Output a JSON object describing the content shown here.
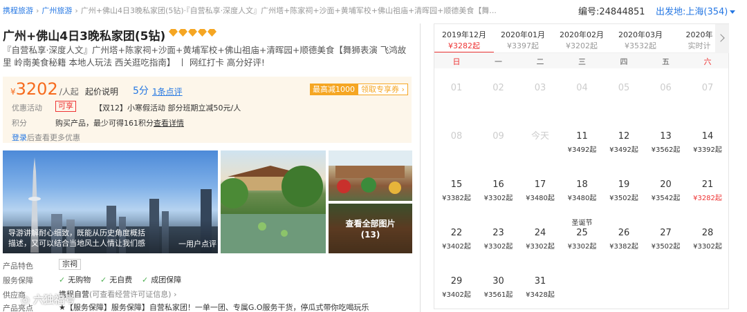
{
  "breadcrumb": {
    "items": [
      "携程旅游",
      "广州旅游"
    ],
    "current": "广州+佛山4日3晚私家团(5钻)·『自营私享·深度人文』广州塔+陈家祠+沙面+黄埔军校+佛山祖庙+清晖园+顺德美食【舞..."
  },
  "product_code": "编号:24844851",
  "depart_city": "出发地:上海(354)",
  "title": "广州+佛山4日3晚私家团(5钻)",
  "diamond_count": 5,
  "subtitle": "『自营私享·深度人文』广州塔+陈家祠+沙面+黄埔军校+佛山祖庙+清晖园+顺德美食【舞狮表演 飞鸿故里 岭南美食秘籍 本地人玩法 西关逛吃指南】 丨 网红打卡 高分好评!",
  "price": {
    "currency": "¥",
    "amount": "3202",
    "unit": "/人起",
    "explain": "起价说明",
    "score": "5分",
    "reviews": "1条点评",
    "max_discount": "最高减1000",
    "coupon": "领取专享券 ›"
  },
  "promo": {
    "label": "优惠活动",
    "tag": "可享",
    "text": "【双12】小寒假活动 部分班期立减50元/人"
  },
  "points": {
    "label": "积分",
    "text": "购买产品，最少可得161积分",
    "link": "查看详情"
  },
  "login": {
    "link": "登录",
    "text": "后查看更多优惠"
  },
  "gallery": {
    "main_caption_1": "导游讲解耐心细致，既能从历史角度概括",
    "main_caption_2": "描述，又可以结合当地风土人情让我们感",
    "main_review": "一用户点评",
    "view_all_1": "查看全部图片",
    "view_all_2": "(13)"
  },
  "features": {
    "label": "产品特色",
    "tag": "宗祠"
  },
  "guarantee": {
    "label": "服务保障",
    "items": [
      "无购物",
      "无自费",
      "成团保障"
    ]
  },
  "info": {
    "label": "供应商",
    "text": "携程自营",
    "sub": "(可查看经营许可证信息) ›"
  },
  "service": {
    "label": "产品亮点",
    "text": "★【服务保障】服务保障】自营私家团！一单一团、专属G.O服务干货，停瓜式带你吃喝玩乐"
  },
  "watermark": "◎ 六独福号",
  "calendar": {
    "months": [
      {
        "m": "2019年12月",
        "p": "¥3282起",
        "active": true
      },
      {
        "m": "2020年01月",
        "p": "¥3397起"
      },
      {
        "m": "2020年02月",
        "p": "¥3202起"
      },
      {
        "m": "2020年03月",
        "p": "¥3532起"
      },
      {
        "m": "2020年",
        "p": "实时计"
      }
    ],
    "weekdays": [
      "日",
      "一",
      "二",
      "三",
      "四",
      "五",
      "六"
    ],
    "weeks": [
      [
        {
          "d": "01",
          "past": true
        },
        {
          "d": "02",
          "past": true
        },
        {
          "d": "03",
          "past": true
        },
        {
          "d": "04",
          "past": true
        },
        {
          "d": "05",
          "past": true
        },
        {
          "d": "06",
          "past": true
        },
        {
          "d": "07",
          "past": true
        }
      ],
      [
        {
          "d": "08",
          "past": true
        },
        {
          "d": "09",
          "past": true
        },
        {
          "d": "今天",
          "past": true
        },
        {
          "d": "11",
          "p": "¥3492起"
        },
        {
          "d": "12",
          "p": "¥3492起"
        },
        {
          "d": "13",
          "p": "¥3562起"
        },
        {
          "d": "14",
          "p": "¥3392起"
        }
      ],
      [
        {
          "d": "15",
          "p": "¥3382起"
        },
        {
          "d": "16",
          "p": "¥3302起"
        },
        {
          "d": "17",
          "p": "¥3480起"
        },
        {
          "d": "18",
          "p": "¥3480起"
        },
        {
          "d": "19",
          "p": "¥3502起"
        },
        {
          "d": "20",
          "p": "¥3542起"
        },
        {
          "d": "21",
          "p": "¥3282起",
          "low": true
        }
      ],
      [
        {
          "d": "22",
          "p": "¥3402起"
        },
        {
          "d": "23",
          "p": "¥3302起"
        },
        {
          "d": "24",
          "p": "¥3302起"
        },
        {
          "d": "25",
          "p": "¥3302起",
          "hol": "圣诞节"
        },
        {
          "d": "26",
          "p": "¥3382起"
        },
        {
          "d": "27",
          "p": "¥3502起"
        },
        {
          "d": "28",
          "p": "¥3302起"
        }
      ],
      [
        {
          "d": "29",
          "p": "¥3402起"
        },
        {
          "d": "30",
          "p": "¥3561起"
        },
        {
          "d": "31",
          "p": "¥3428起"
        }
      ]
    ]
  }
}
